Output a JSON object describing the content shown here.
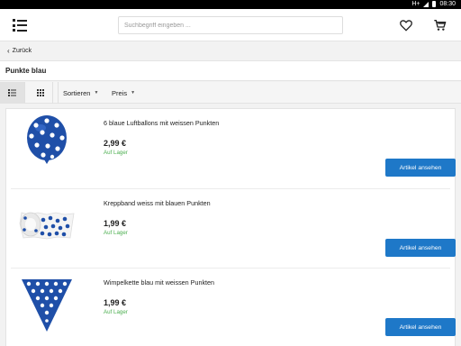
{
  "status_bar": {
    "network": "H+",
    "time": "08:30"
  },
  "header": {
    "search_placeholder": "Suchbegriff eingeben ...",
    "menu_icon": "menu-icon",
    "wishlist_icon": "heart-icon",
    "cart_icon": "cart-icon"
  },
  "navigation": {
    "back_label": "Zurück"
  },
  "page": {
    "title": "Punkte blau"
  },
  "toolbar": {
    "sort_label": "Sortieren",
    "price_label": "Preis"
  },
  "products": [
    {
      "name": "6 blaue Luftballons mit weissen Punkten",
      "price": "2,99 €",
      "stock": "Auf Lager",
      "button": "Artikel ansehen"
    },
    {
      "name": "Kreppband weiss mit blauen Punkten",
      "price": "1,99 €",
      "stock": "Auf Lager",
      "button": "Artikel ansehen"
    },
    {
      "name": "Wimpelkette blau mit weissen Punkten",
      "price": "1,99 €",
      "stock": "Auf Lager",
      "button": "Artikel ansehen"
    }
  ],
  "colors": {
    "primary_button": "#1e78c8",
    "stock_green": "#4caf50",
    "product_blue": "#1f4fa8"
  }
}
